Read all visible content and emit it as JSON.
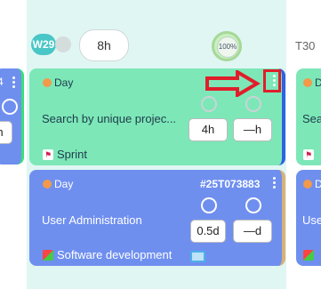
{
  "header": {
    "week_label": "W29",
    "hours": "8h",
    "percent": "100%",
    "next_week_label": "T30"
  },
  "left_card": {
    "value": "h",
    "partial_text": "4"
  },
  "cards": [
    {
      "type_label": "Day",
      "title": "Search by unique projec...",
      "estimate": "4h",
      "remaining": "—h",
      "tag_label": "Sprint",
      "accent": "#7de7b8"
    },
    {
      "type_label": "Day",
      "id": "#25T073883",
      "title": "User Administration",
      "estimate": "0.5d",
      "remaining": "—d",
      "tag_label": "Software development",
      "accent": "#6f8fef"
    }
  ],
  "right_cards": [
    {
      "type_prefix": "D",
      "title_prefix": "Sea"
    },
    {
      "type_prefix": "D",
      "title_prefix": "Use"
    }
  ],
  "annotation": {
    "color": "#e01e2a"
  }
}
